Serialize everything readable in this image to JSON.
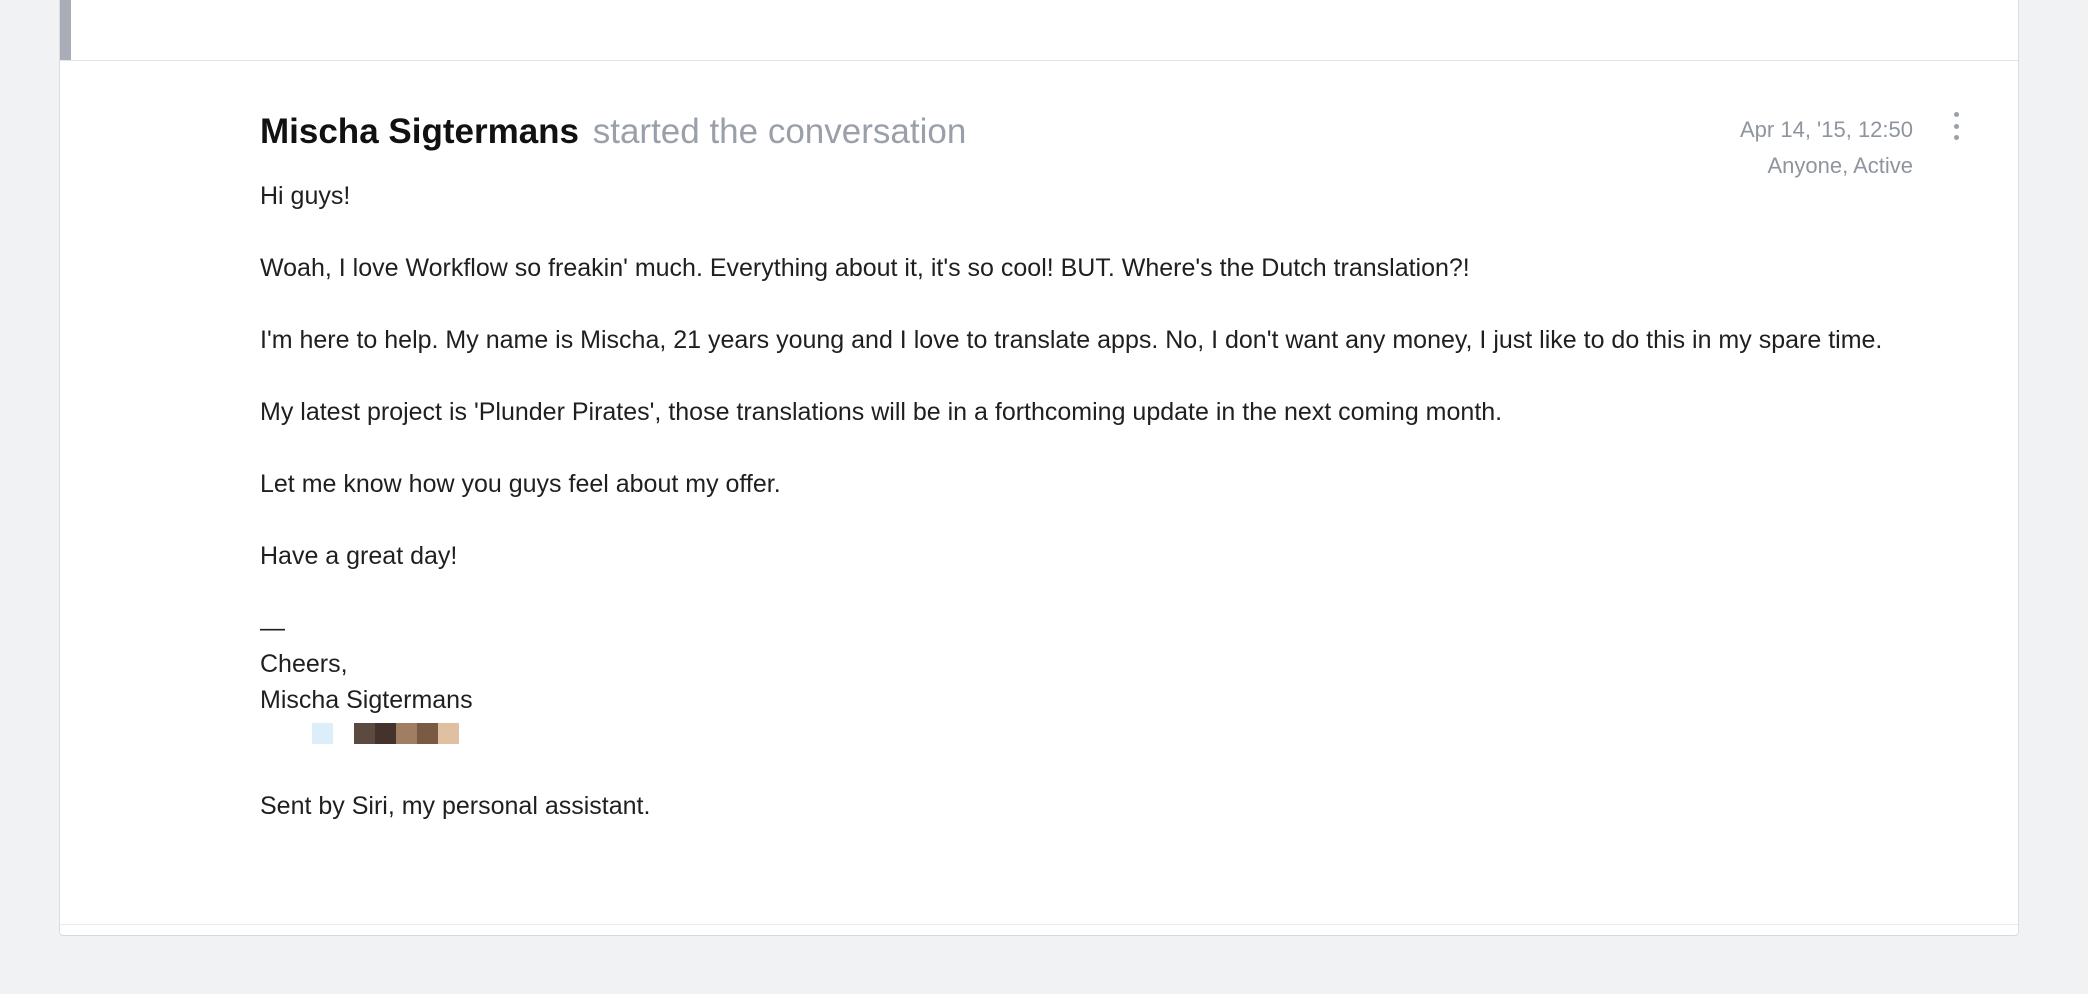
{
  "post": {
    "author": "Mischa Sigtermans",
    "action": "started the conversation",
    "date": "Apr 14, '15, 12:50",
    "visibility": "Anyone, Active",
    "menu_icon": "vertical-ellipsis-icon",
    "paragraphs": [
      "Hi guys!",
      "Woah, I love Workflow so freakin' much. Everything about it, it's so cool! BUT. Where's the Dutch translation?!",
      "I'm here to help. My name is Mischa, 21 years young and I love to translate apps. No, I don't want any money, I just like to do this in my spare time.",
      "My latest project is 'Plunder Pirates', those translations will be in a forthcoming update in the next coming month.",
      "Let me know how you guys feel about my offer.",
      "Have a great day!"
    ],
    "signature": {
      "dash": "—",
      "closing": "Cheers,",
      "name": "Mischa Sigtermans",
      "emoji_colors": [
        "#dbeefa",
        "#5a4a40",
        "#43332c",
        "#a07e62",
        "#7a5a42",
        "#e0c0a0"
      ]
    },
    "footer": "Sent by Siri, my personal assistant."
  },
  "colors": {
    "background": "#f1f2f4",
    "card": "#ffffff",
    "accent_bar": "#a8adb8",
    "muted_text": "#9aa0aa"
  }
}
